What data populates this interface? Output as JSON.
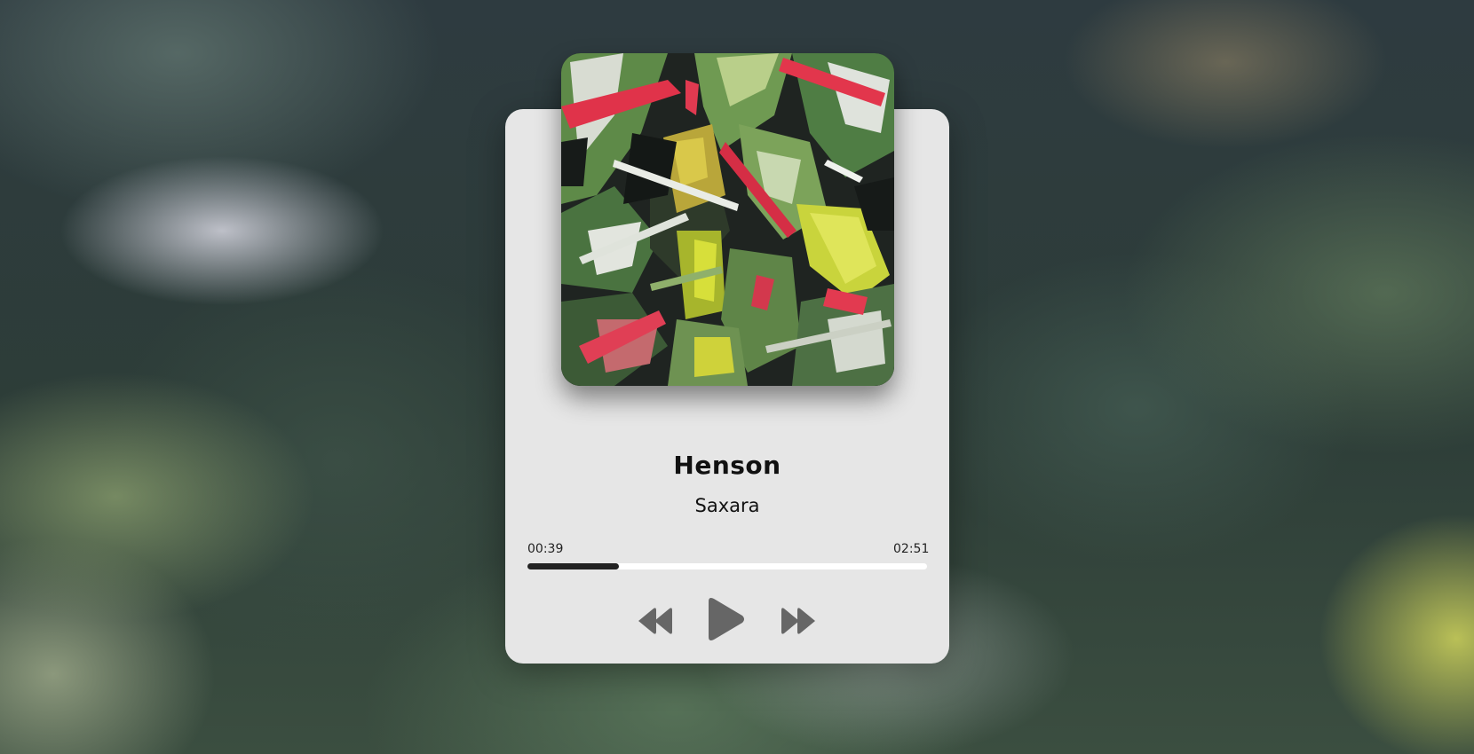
{
  "track": {
    "title": "Henson",
    "artist": "Saxara",
    "current_time": "00:39",
    "duration": "02:51",
    "progress_fraction": 0.228
  },
  "controls": {
    "previous_icon": "rewind-icon",
    "play_icon": "play-icon",
    "next_icon": "fast-forward-icon"
  },
  "colors": {
    "card": "#e6e6e6",
    "progress_track": "#ffffff",
    "progress_fill": "#222222",
    "controls": "#666666"
  }
}
